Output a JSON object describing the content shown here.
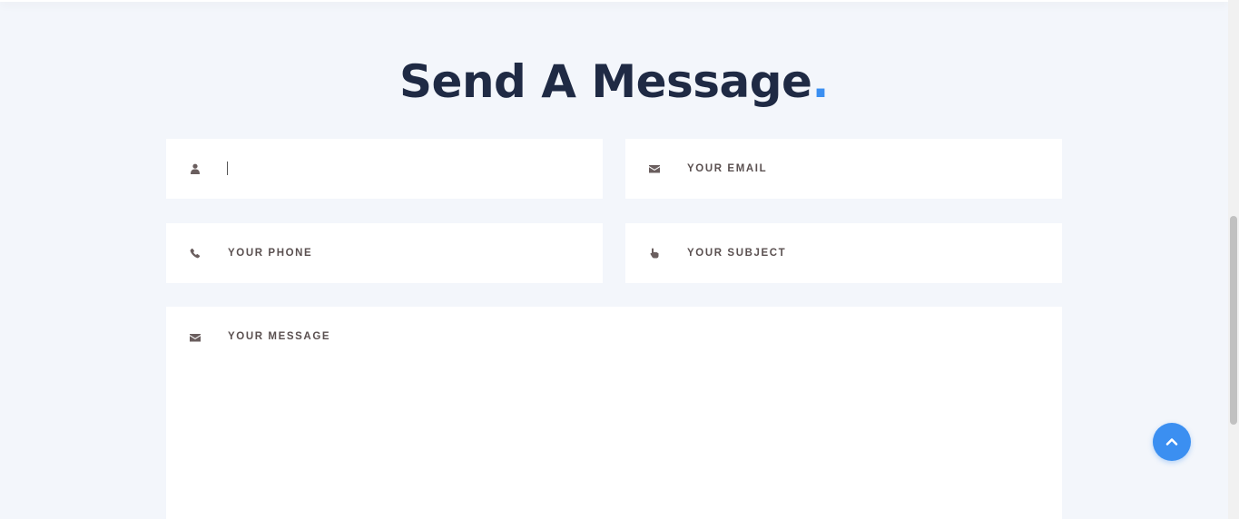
{
  "section": {
    "title": "Send A Message",
    "title_dot": "."
  },
  "form": {
    "name": {
      "placeholder": "",
      "value": "",
      "icon": "user-icon"
    },
    "email": {
      "placeholder": "YOUR EMAIL",
      "icon": "envelope-icon"
    },
    "phone": {
      "placeholder": "YOUR PHONE",
      "icon": "phone-icon"
    },
    "subject": {
      "placeholder": "YOUR SUBJECT",
      "icon": "hand-pointer-icon"
    },
    "message": {
      "placeholder": "YOUR MESSAGE",
      "icon": "envelope-icon"
    }
  },
  "back_to_top": {
    "icon": "chevron-up-icon"
  },
  "colors": {
    "background": "#f3f6fb",
    "heading": "#1f2a44",
    "accent": "#3b8ff1",
    "field_bg": "#ffffff",
    "placeholder_text": "#5a5050"
  }
}
